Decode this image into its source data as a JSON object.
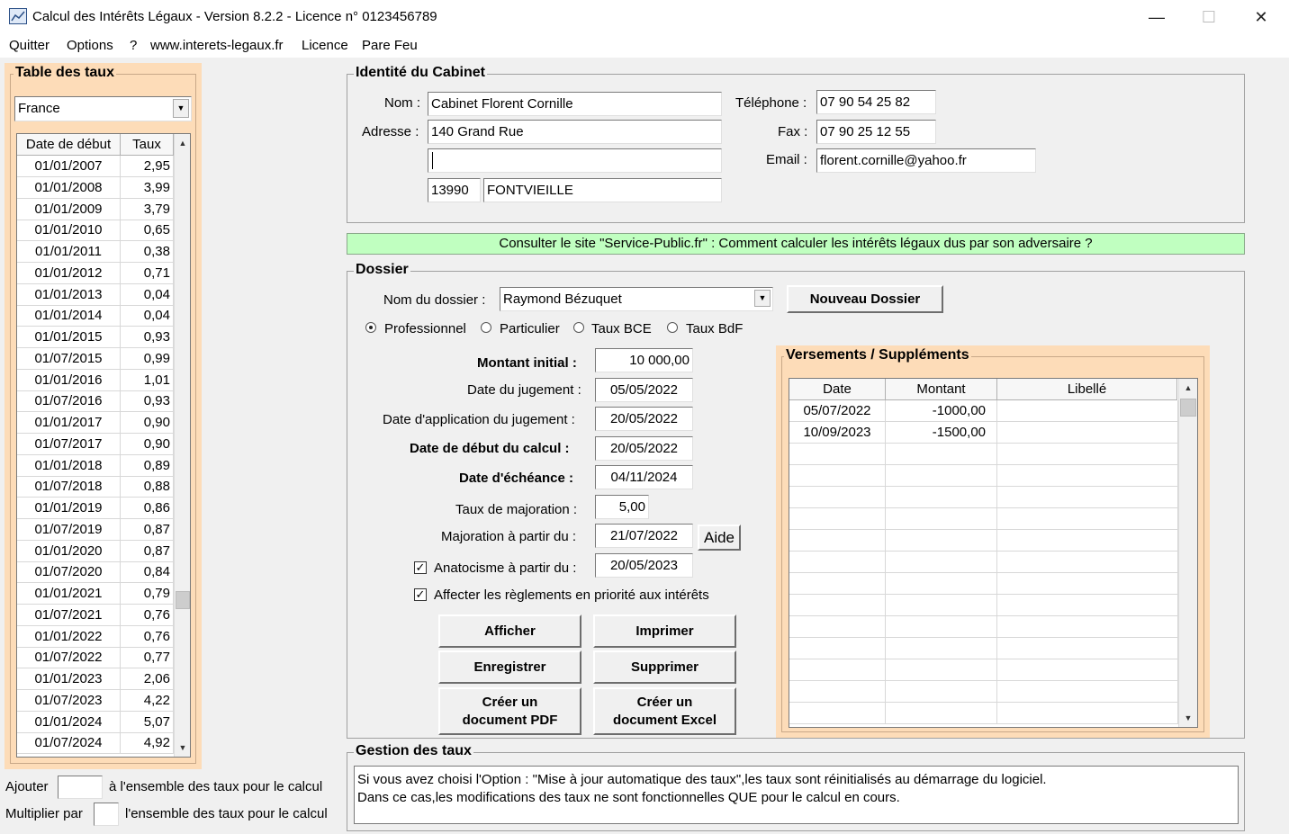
{
  "window": {
    "title": "Calcul des Intérêts Légaux - Version 8.2.2 - Licence n° 0123456789",
    "minimize": "—",
    "maximize": "☐",
    "close": "✕"
  },
  "menu": [
    "Quitter",
    "Options",
    "?",
    "www.interets-legaux.fr",
    "Licence",
    "Pare Feu"
  ],
  "rates_table": {
    "title": "Table des taux",
    "country": "France",
    "headers": [
      "Date de début",
      "Taux"
    ],
    "rows": [
      [
        "01/01/2007",
        "2,95"
      ],
      [
        "01/01/2008",
        "3,99"
      ],
      [
        "01/01/2009",
        "3,79"
      ],
      [
        "01/01/2010",
        "0,65"
      ],
      [
        "01/01/2011",
        "0,38"
      ],
      [
        "01/01/2012",
        "0,71"
      ],
      [
        "01/01/2013",
        "0,04"
      ],
      [
        "01/01/2014",
        "0,04"
      ],
      [
        "01/01/2015",
        "0,93"
      ],
      [
        "01/07/2015",
        "0,99"
      ],
      [
        "01/01/2016",
        "1,01"
      ],
      [
        "01/07/2016",
        "0,93"
      ],
      [
        "01/01/2017",
        "0,90"
      ],
      [
        "01/07/2017",
        "0,90"
      ],
      [
        "01/01/2018",
        "0,89"
      ],
      [
        "01/07/2018",
        "0,88"
      ],
      [
        "01/01/2019",
        "0,86"
      ],
      [
        "01/07/2019",
        "0,87"
      ],
      [
        "01/01/2020",
        "0,87"
      ],
      [
        "01/07/2020",
        "0,84"
      ],
      [
        "01/01/2021",
        "0,79"
      ],
      [
        "01/07/2021",
        "0,76"
      ],
      [
        "01/01/2022",
        "0,76"
      ],
      [
        "01/07/2022",
        "0,77"
      ],
      [
        "01/01/2023",
        "2,06"
      ],
      [
        "01/07/2023",
        "4,22"
      ],
      [
        "01/01/2024",
        "5,07"
      ],
      [
        "01/07/2024",
        "4,92"
      ]
    ]
  },
  "bottom_left": {
    "ajouter_label": "Ajouter",
    "ajouter_suffix": "à l'ensemble des taux pour le calcul",
    "multiplier_label": "Multiplier par",
    "multiplier_suffix": "l'ensemble des taux pour le calcul"
  },
  "cabinet": {
    "title": "Identité du Cabinet",
    "nom_label": "Nom :",
    "nom": "Cabinet Florent Cornille",
    "adresse_label": "Adresse :",
    "adresse1": "140 Grand Rue",
    "adresse2": "",
    "cp": "13990",
    "ville": "FONTVIEILLE",
    "tel_label": "Téléphone :",
    "tel": "07 90 54 25 82",
    "fax_label": "Fax :",
    "fax": "07 90 25 12 55",
    "email_label": "Email :",
    "email": "florent.cornille@yahoo.fr"
  },
  "banner": {
    "text": "Consulter le site \"Service-Public.fr\" : Comment calculer les intérêts légaux dus par son adversaire ?",
    "color": "#c0ffc0"
  },
  "dossier": {
    "title": "Dossier",
    "nom_label": "Nom du dossier :",
    "nom": "Raymond Bézuquet",
    "nouveau_button": "Nouveau Dossier",
    "radios": [
      "Professionnel",
      "Particulier",
      "Taux BCE",
      "Taux BdF"
    ],
    "montant_label": "Montant initial :",
    "montant": "10 000,00",
    "jugement_label": "Date du jugement :",
    "jugement": "05/05/2022",
    "application_label": "Date d'application du jugement :",
    "application": "20/05/2022",
    "debut_label": "Date de début du calcul :",
    "debut": "20/05/2022",
    "echeance_label": "Date d'échéance :",
    "echeance": "04/11/2024",
    "majoration_label": "Taux de majoration :",
    "majoration": "5,00",
    "maj_partir_label": "Majoration à partir du :",
    "maj_partir": "21/07/2022",
    "aide_button": "Aide",
    "anatocisme_label": "Anatocisme à partir du :",
    "anatocisme": "20/05/2023",
    "affecter_label": "Affecter les règlements en priorité aux intérêts",
    "buttons": {
      "afficher": "Afficher",
      "imprimer": "Imprimer",
      "enregistrer": "Enregistrer",
      "supprimer": "Supprimer",
      "pdf_line1": "Créer un",
      "pdf_line2": "document PDF",
      "excel_line1": "Créer un",
      "excel_line2": "document Excel"
    }
  },
  "versements": {
    "title": "Versements / Suppléments",
    "headers": [
      "Date",
      "Montant",
      "Libellé"
    ],
    "rows": [
      [
        "05/07/2022",
        "-1000,00",
        ""
      ],
      [
        "10/09/2023",
        "-1500,00",
        ""
      ]
    ]
  },
  "gestion": {
    "title": "Gestion des taux",
    "line1": "Si vous avez choisi l'Option : \"Mise à jour automatique des taux\",les taux sont réinitialisés au démarrage du logiciel.",
    "line2": "Dans ce cas,les modifications des taux ne sont fonctionnelles QUE pour le calcul en cours."
  }
}
